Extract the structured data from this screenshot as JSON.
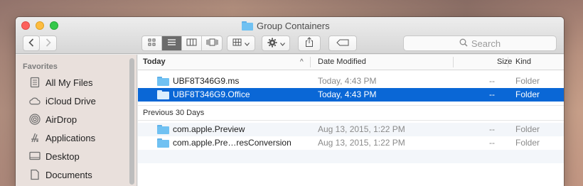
{
  "window": {
    "title": "Group Containers"
  },
  "toolbar": {
    "back_icon": "chevron-left",
    "forward_icon": "chevron-right",
    "views": [
      "icon-view",
      "list-view",
      "column-view",
      "coverflow-view"
    ],
    "active_view": "list-view",
    "arrange_icon": "arrange-grid",
    "action_icon": "gear",
    "share_icon": "share",
    "tag_icon": "tag"
  },
  "search": {
    "placeholder": "Search"
  },
  "sidebar": {
    "heading": "Favorites",
    "items": [
      {
        "label": "All My Files",
        "icon": "all-files"
      },
      {
        "label": "iCloud Drive",
        "icon": "cloud"
      },
      {
        "label": "AirDrop",
        "icon": "airdrop"
      },
      {
        "label": "Applications",
        "icon": "applications"
      },
      {
        "label": "Desktop",
        "icon": "desktop"
      },
      {
        "label": "Documents",
        "icon": "documents"
      }
    ]
  },
  "columns": {
    "name": "Today",
    "date": "Date Modified",
    "size": "Size",
    "kind": "Kind",
    "sort_indicator": "^"
  },
  "groups": [
    {
      "heading": "Today",
      "rows": [
        {
          "name": "UBF8T346G9.ms",
          "date": "Today, 4:43 PM",
          "size": "--",
          "kind": "Folder",
          "selected": false
        },
        {
          "name": "UBF8T346G9.Office",
          "date": "Today, 4:43 PM",
          "size": "--",
          "kind": "Folder",
          "selected": true
        }
      ]
    },
    {
      "heading": "Previous 30 Days",
      "rows": [
        {
          "name": "com.apple.Preview",
          "date": "Aug 13, 2015, 1:22 PM",
          "size": "--",
          "kind": "Folder",
          "selected": false
        },
        {
          "name": "com.apple.Pre…resConversion",
          "date": "Aug 13, 2015, 1:22 PM",
          "size": "--",
          "kind": "Folder",
          "selected": false
        }
      ]
    }
  ]
}
